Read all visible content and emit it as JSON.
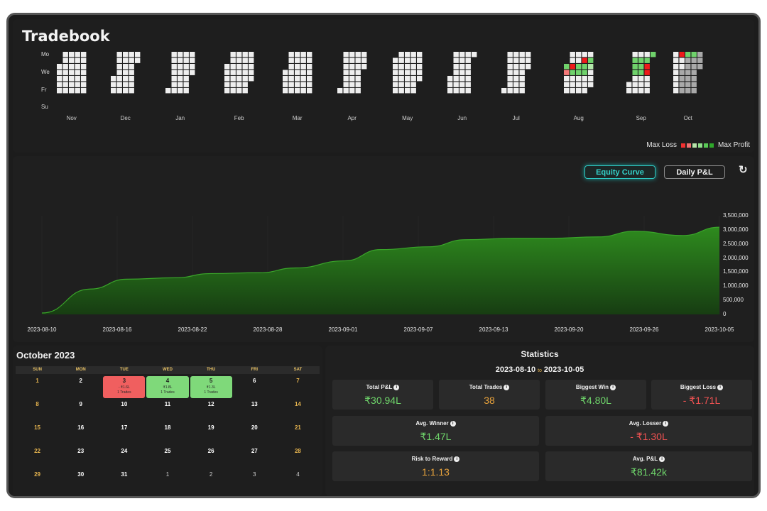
{
  "app": {
    "title": "Tradebook"
  },
  "heatmap": {
    "day_labels": [
      "Mo",
      "We",
      "Fr",
      "Su"
    ],
    "months": [
      "Nov",
      "Dec",
      "Jan",
      "Feb",
      "Mar",
      "Apr",
      "May",
      "Jun",
      "Jul",
      "Aug",
      "Sep",
      "Oct"
    ],
    "legend": {
      "min_label": "Max Loss",
      "max_label": "Max Profit",
      "colors": [
        "#f23030",
        "#f07070",
        "#b6e5a9",
        "#8fe08a",
        "#58c955",
        "#2ea82a"
      ]
    },
    "colors": {
      "empty": "#eeeeee",
      "future": "#a9a9a9",
      "loss": "#ee1a1a",
      "loss_light": "#f47878",
      "profit": "#6fd26b",
      "profit_light": "#b3e8aa"
    }
  },
  "chart_controls": {
    "equity_curve": "Equity Curve",
    "daily_pnl": "Daily P&L",
    "refresh_icon": "refresh-icon"
  },
  "chart_data": {
    "type": "area",
    "x": [
      "2023-08-10",
      "2023-08-14",
      "2023-08-17",
      "2023-08-21",
      "2023-08-24",
      "2023-08-28",
      "2023-08-31",
      "2023-09-04",
      "2023-09-07",
      "2023-09-11",
      "2023-09-14",
      "2023-09-18",
      "2023-09-21",
      "2023-09-25",
      "2023-09-28",
      "2023-10-02",
      "2023-10-05"
    ],
    "x_ticks": [
      "2023-08-10",
      "2023-08-16",
      "2023-08-22",
      "2023-08-28",
      "2023-09-01",
      "2023-09-07",
      "2023-09-13",
      "2023-09-20",
      "2023-09-26",
      "2023-10-05"
    ],
    "values": [
      50000,
      900000,
      1250000,
      1300000,
      1450000,
      1480000,
      1650000,
      1900000,
      2300000,
      2400000,
      2650000,
      2700000,
      2700000,
      2750000,
      2950000,
      2800000,
      3094000
    ],
    "y_ticks": [
      "3,500,000",
      "3,000,000",
      "2,500,000",
      "2,000,000",
      "1,500,000",
      "1,000,000",
      "500,000",
      "0"
    ],
    "ylim": [
      0,
      3500000
    ],
    "grid": false,
    "title": "",
    "xlabel": "",
    "ylabel": "",
    "fill_color": "#2e8b1e"
  },
  "calendar": {
    "title": "October 2023",
    "weekdays": [
      "SUN",
      "MON",
      "TUE",
      "WED",
      "THU",
      "FRI",
      "SAT"
    ],
    "days": [
      {
        "d": "1"
      },
      {
        "d": "2"
      },
      {
        "d": "3",
        "pnl": "- ₹1.6L",
        "trades": "1 Trades"
      },
      {
        "d": "4",
        "pnl": "₹1.8L",
        "trades": "1 Trades"
      },
      {
        "d": "5",
        "pnl": "₹1.3L",
        "trades": "1 Trades"
      },
      {
        "d": "6"
      },
      {
        "d": "7"
      },
      {
        "d": "8"
      },
      {
        "d": "9"
      },
      {
        "d": "10"
      },
      {
        "d": "11"
      },
      {
        "d": "12"
      },
      {
        "d": "13"
      },
      {
        "d": "14"
      },
      {
        "d": "15"
      },
      {
        "d": "16"
      },
      {
        "d": "17"
      },
      {
        "d": "18"
      },
      {
        "d": "19"
      },
      {
        "d": "20"
      },
      {
        "d": "21"
      },
      {
        "d": "22"
      },
      {
        "d": "23"
      },
      {
        "d": "24"
      },
      {
        "d": "25"
      },
      {
        "d": "26"
      },
      {
        "d": "27"
      },
      {
        "d": "28"
      },
      {
        "d": "29"
      },
      {
        "d": "30"
      },
      {
        "d": "31"
      },
      {
        "d": "1"
      },
      {
        "d": "2"
      },
      {
        "d": "3"
      },
      {
        "d": "4"
      }
    ]
  },
  "stats": {
    "title": "Statistics",
    "range_from": "2023-08-10",
    "range_to_word": "to",
    "range_to": "2023-10-05",
    "cards": {
      "total_pnl": {
        "label": "Total P&L",
        "value": "₹30.94L"
      },
      "total_trades": {
        "label": "Total Trades",
        "value": "38"
      },
      "biggest_win": {
        "label": "Biggest Win",
        "value": "₹4.80L"
      },
      "biggest_loss": {
        "label": "Biggest Loss",
        "value": "- ₹1.71L"
      },
      "avg_winner": {
        "label": "Avg. Winner",
        "value": "₹1.47L"
      },
      "avg_loser": {
        "label": "Avg. Losser",
        "value": "- ₹1.30L"
      },
      "risk_reward": {
        "label": "Risk to Reward",
        "value": "1:1.13"
      },
      "avg_pnl": {
        "label": "Avg. P&L",
        "value": "₹81.42k"
      }
    }
  }
}
